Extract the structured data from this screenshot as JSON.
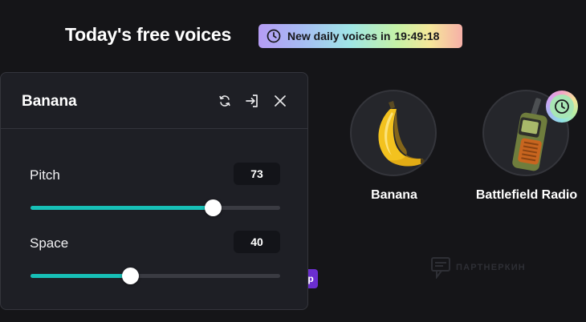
{
  "header": {
    "title": "Today's free voices",
    "daily_badge": {
      "label": "New daily voices in",
      "timer": "19:49:18",
      "icon": "clock-icon"
    }
  },
  "voices": [
    {
      "name": "Banana",
      "icon": "banana-image",
      "premium": false
    },
    {
      "name": "Battlefield Radio",
      "icon": "walkie-talkie-image",
      "premium": true
    }
  ],
  "panel": {
    "title": "Banana",
    "actions": [
      "reset-icon",
      "apply-icon",
      "close-icon"
    ],
    "params": [
      {
        "label": "Pitch",
        "value": "73",
        "fraction": 0.73
      },
      {
        "label": "Space",
        "value": "40",
        "fraction": 0.4
      }
    ]
  },
  "watermark": "ПАРТНЕРКИН",
  "colors": {
    "background": "#151518",
    "panel": "#1e1f25",
    "accent": "#17c0b7",
    "chip": "#6b2ecf"
  }
}
